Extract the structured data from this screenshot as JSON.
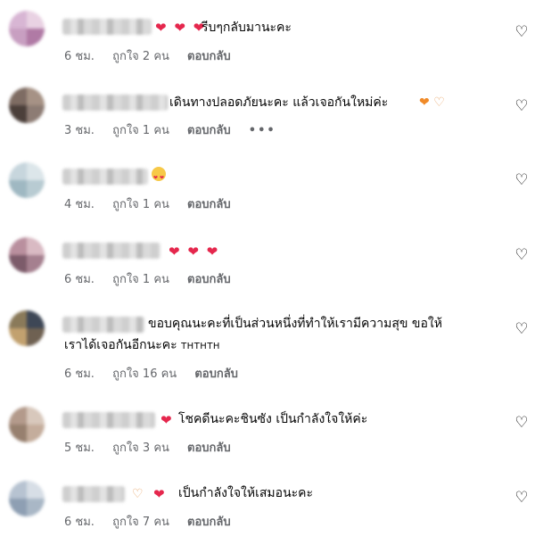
{
  "comments": [
    {
      "text": "รีบๆกลับมานะคะ",
      "time": "6 ชม.",
      "likes": "ถูกใจ 2 คน",
      "reply": "ตอบกลับ",
      "emoji_prefix": "❤ ❤ ❤"
    },
    {
      "text": "เดินทางปลอดภัยนะคะ แล้วเจอกันใหม่ค่ะ",
      "time": "3 ชม.",
      "likes": "ถูกใจ 1 คน",
      "reply": "ตอบกลับ",
      "more": "•••"
    },
    {
      "text": "",
      "time": "4 ชม.",
      "likes": "ถูกใจ 1 คน",
      "reply": "ตอบกลับ"
    },
    {
      "text": "",
      "time": "6 ชม.",
      "likes": "ถูกใจ 1 คน",
      "reply": "ตอบกลับ",
      "emoji_prefix": "❤ ❤ ❤"
    },
    {
      "text": "ขอบคุณนะคะที่เป็นส่วนหนึ่งที่ทำให้เรามีความสุข ขอให้",
      "text2": "เราได้เจอกันอีกนะคะ",
      "suffix": "THTHTH",
      "time": "6 ชม.",
      "likes": "ถูกใจ 16 คน",
      "reply": "ตอบกลับ"
    },
    {
      "text": "โชคดีนะคะชินซัง เป็นกำลังใจให้ค่ะ",
      "time": "5 ชม.",
      "likes": "ถูกใจ 3 คน",
      "reply": "ตอบกลับ",
      "emoji_prefix": "❤"
    },
    {
      "text": "เป็นกำลังใจให้เสมอนะคะ",
      "time": "6 ชม.",
      "likes": "ถูกใจ 7 คน",
      "reply": "ตอบกลับ",
      "emoji_prefix": "❤"
    }
  ],
  "icons": {
    "like": "heart-outline-icon"
  },
  "colors": {
    "heart": "#e5274d",
    "meta": "#65676b"
  }
}
